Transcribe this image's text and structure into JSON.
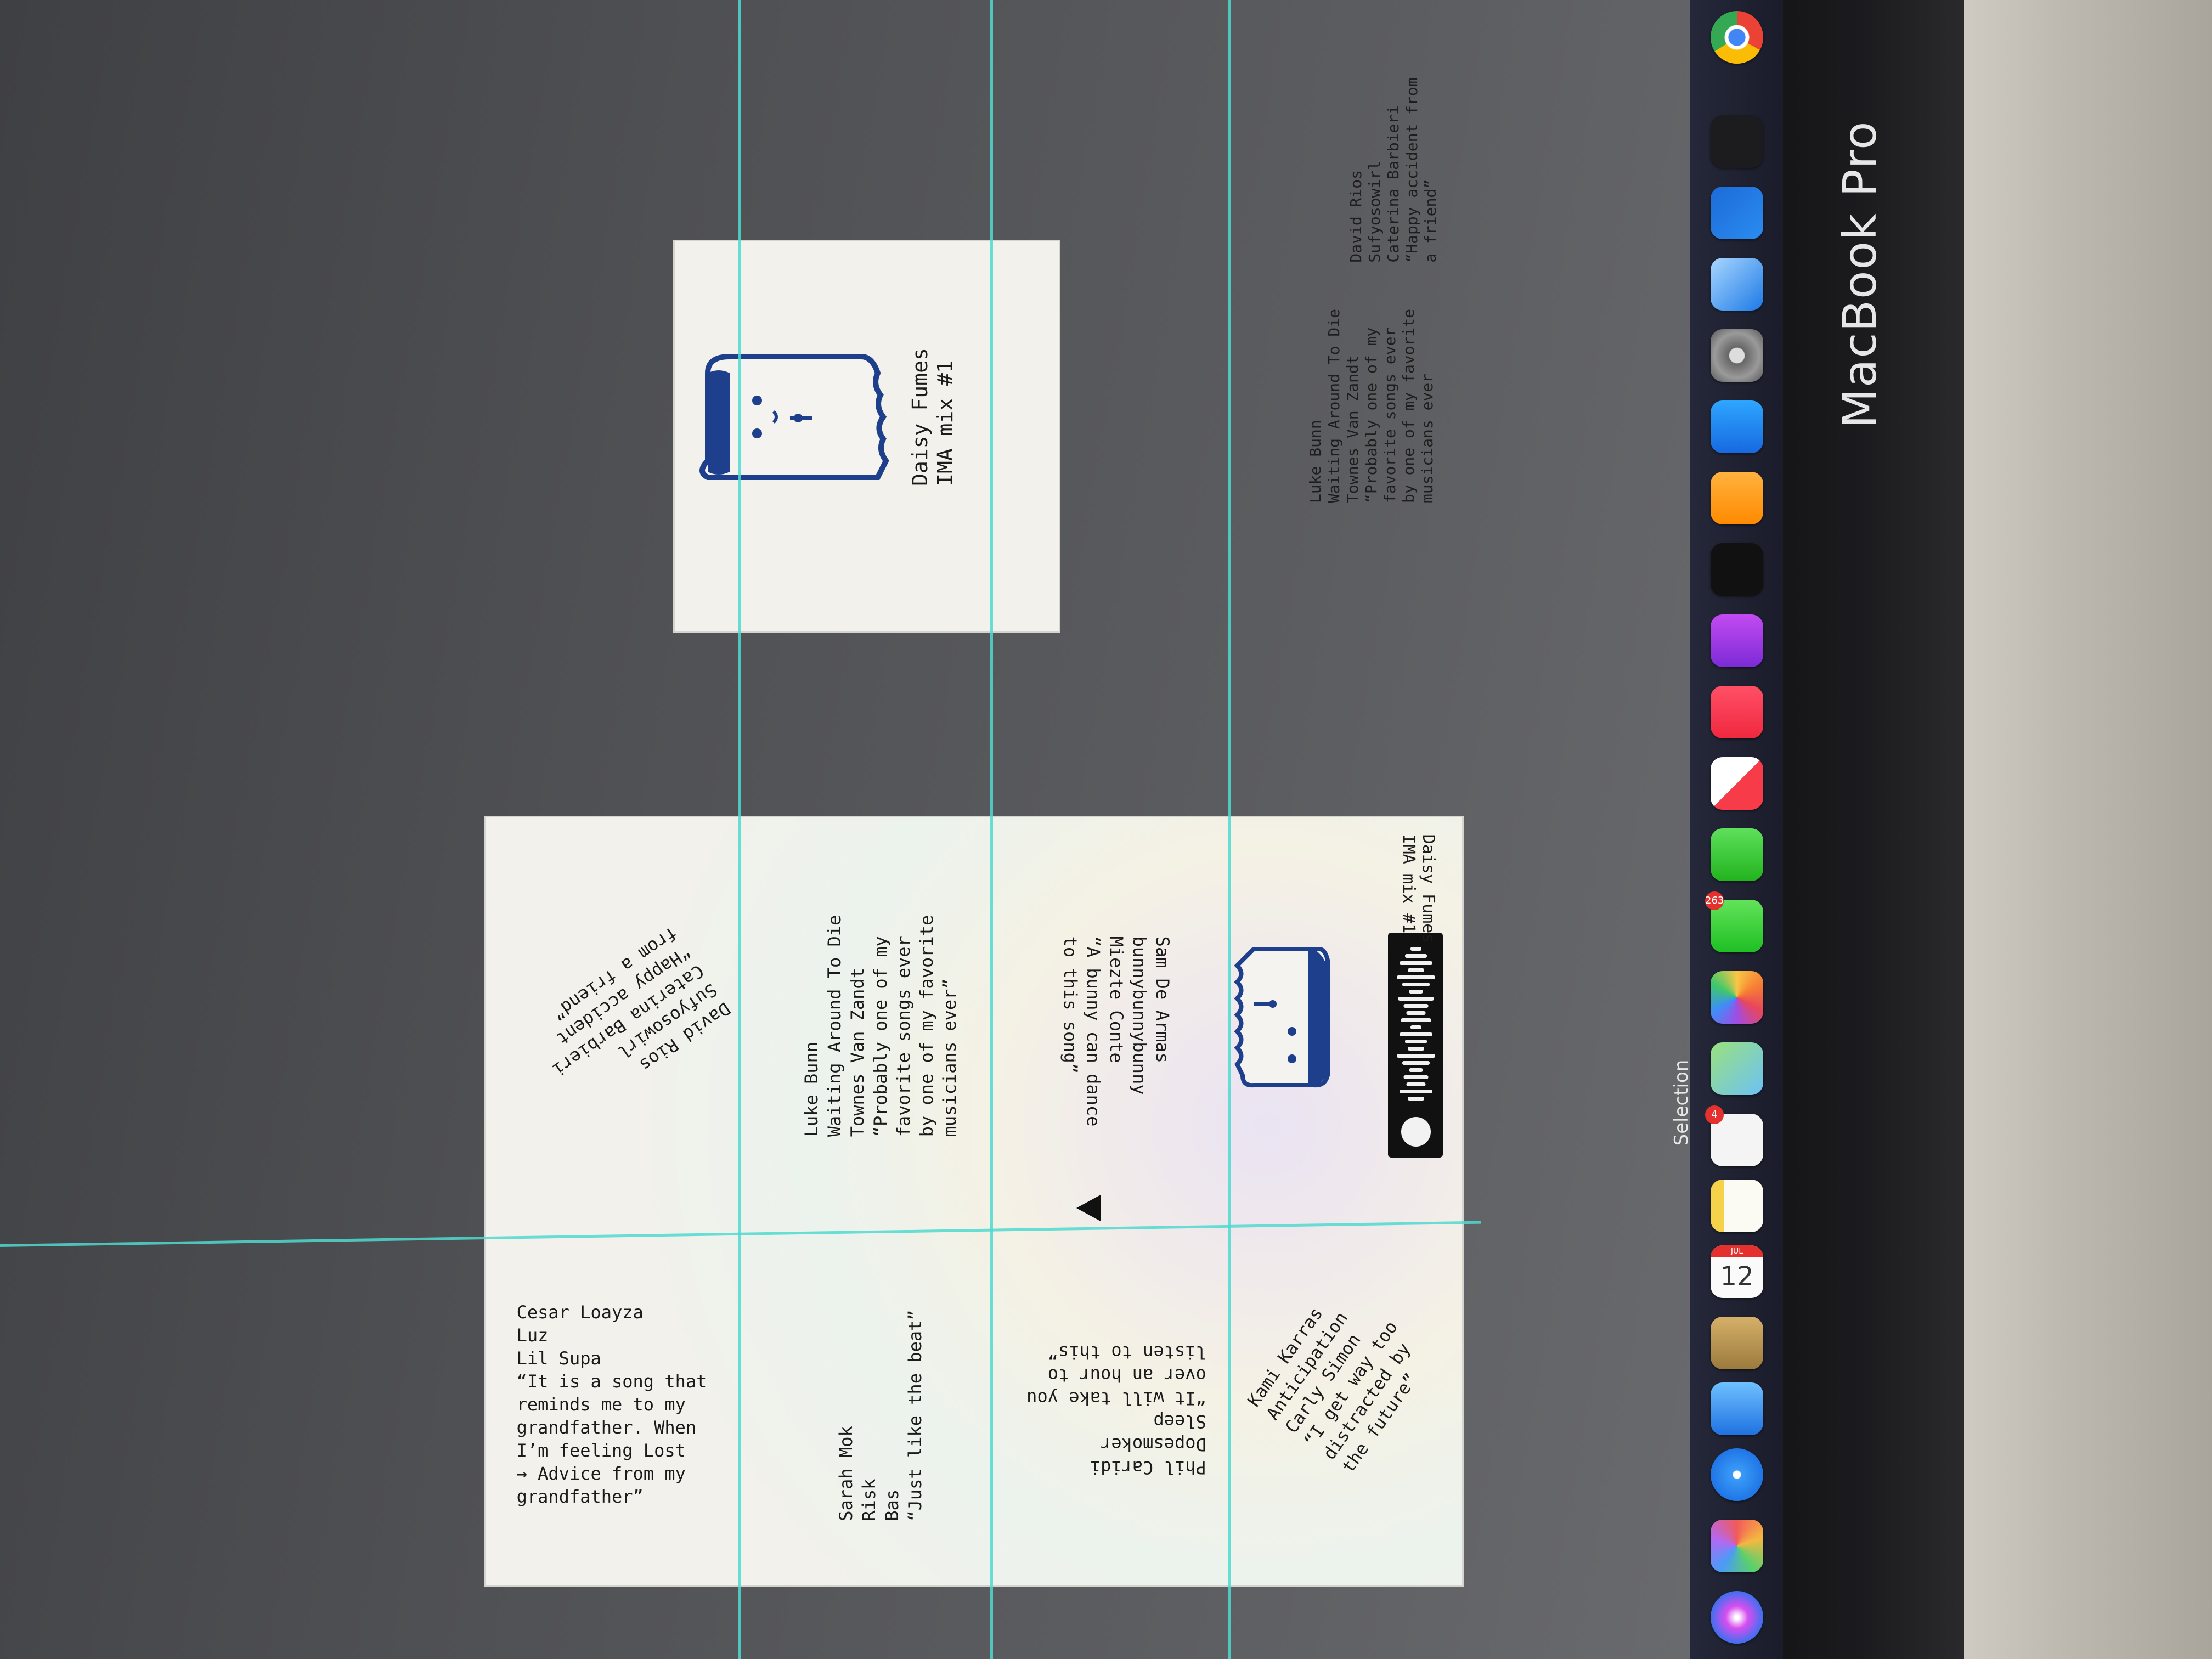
{
  "device": {
    "label": "MacBook Pro"
  },
  "toolbar": {
    "mode_label": "Selection"
  },
  "small_board": {
    "title": "Daisy Fumes",
    "subtitle": "IMA mix #1"
  },
  "big_board": {
    "footer_title": "Daisy Fumes",
    "footer_subtitle": "IMA mix #1",
    "entries": {
      "david": [
        "David Rios",
        "Sufyosowirl",
        "Caterina Barbieri",
        "“Happy accident",
        "from a friend”"
      ],
      "luke": [
        "Luke Bunn",
        "Waiting Around To Die",
        "Townes Van Zandt",
        "“Probably one of my",
        "favorite songs ever",
        "by one of my favorite",
        "musicians ever”"
      ],
      "sam": [
        "Sam De Armas",
        "bunnybunnybunny",
        "Miezte Conte",
        "“A bunny can dance",
        "to this song”"
      ],
      "cesar": [
        "Cesar Loayza",
        "Luz",
        "Lil Supa",
        "“It is a song that",
        "reminds me to my",
        "grandfather. When",
        "I’m feeling Lost",
        "→ Advice from my",
        "grandfather”"
      ],
      "sarah": [
        "Sarah Mok",
        "Risk",
        "Bas",
        "“Just like the beat”"
      ],
      "phil": [
        "Phil Caridi",
        "Dopesmoker",
        "Sleep",
        "“It will take you",
        "over an hour to",
        "listen to this”"
      ],
      "kami": [
        "Kami Karras",
        "Anticipation",
        "Carly Simon",
        "“I get way too",
        "distracted by",
        "the future”"
      ]
    }
  },
  "side_notes": {
    "luke": [
      "Luke Bunn",
      "Waiting Around To Die",
      "Townes Van Zandt",
      "“Probably one of my",
      "favorite songs ever",
      "by one of my favorite",
      "musicians ever"
    ],
    "david": [
      "David Rios",
      "Sufyosowirl",
      "Caterina Barbieri",
      "“Happy accident from",
      "a friend”"
    ]
  },
  "dock": {
    "calendar_month": "JUL",
    "calendar_day": "12",
    "badges": {
      "reminders": "4",
      "messages": "263"
    },
    "icons": [
      "siri-icon",
      "launchpad-icon",
      "safari-icon",
      "mail-icon",
      "contacts-icon",
      "calendar-icon",
      "notes-icon",
      "reminders-icon",
      "maps-icon",
      "photos-icon",
      "messages-icon",
      "facetime-icon",
      "news-icon",
      "music-icon",
      "podcasts-icon",
      "tv-icon",
      "books-icon",
      "app-store-icon",
      "system-settings-icon",
      "xcode-icon",
      "figma-icon",
      "terminal-icon",
      "chrome-icon"
    ]
  }
}
